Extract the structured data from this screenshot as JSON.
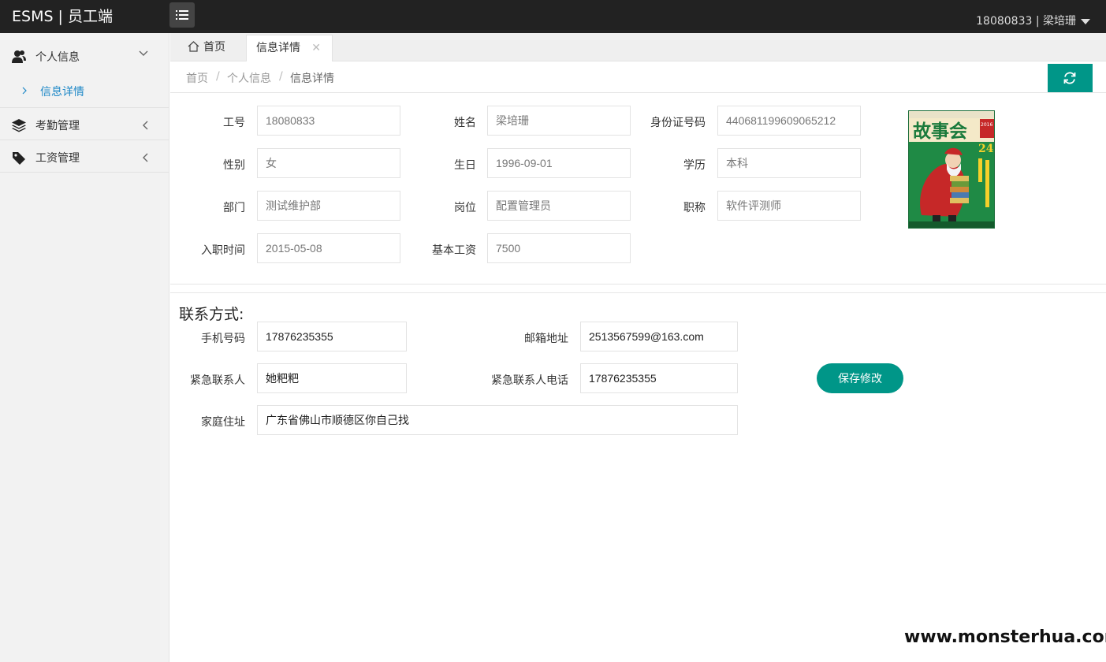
{
  "app": {
    "title": "ESMS | 员工端",
    "user": "18080833 | 梁培珊"
  },
  "sidebar": {
    "groups": [
      {
        "label": "个人信息",
        "icon": "users-icon",
        "expanded": true
      },
      {
        "label": "考勤管理",
        "icon": "layers-icon",
        "expanded": false
      },
      {
        "label": "工资管理",
        "icon": "tag-icon",
        "expanded": false
      }
    ],
    "sub_items": [
      {
        "label": "信息详情",
        "active": true
      }
    ]
  },
  "tabs": [
    {
      "label": "首页",
      "icon": "home-icon"
    },
    {
      "label": "信息详情",
      "active": true,
      "closable": true
    }
  ],
  "breadcrumb": [
    "首页",
    "个人信息",
    "信息详情"
  ],
  "profile": {
    "fields": [
      {
        "label": "工号",
        "value": "18080833"
      },
      {
        "label": "姓名",
        "value": "梁培珊"
      },
      {
        "label": "身份证号码",
        "value": "440681199609065212"
      },
      {
        "label": "性别",
        "value": "女"
      },
      {
        "label": "生日",
        "value": "1996-09-01"
      },
      {
        "label": "学历",
        "value": "本科"
      },
      {
        "label": "部门",
        "value": "测试维护部"
      },
      {
        "label": "岗位",
        "value": "配置管理员"
      },
      {
        "label": "职称",
        "value": "软件评测师"
      },
      {
        "label": "入职时间",
        "value": "2015-05-08"
      },
      {
        "label": "基本工资",
        "value": "7500"
      }
    ],
    "photo": {
      "title": "故事会",
      "issue": "24",
      "year": "2016"
    }
  },
  "contact": {
    "title": "联系方式:",
    "fields": [
      {
        "label": "手机号码",
        "value": "17876235355"
      },
      {
        "label": "邮箱地址",
        "value": "2513567599@163.com"
      },
      {
        "label": "紧急联系人",
        "value": "她粑粑"
      },
      {
        "label": "紧急联系人电话",
        "value": "17876235355"
      },
      {
        "label": "家庭住址",
        "value": "广东省佛山市顺德区你自己找"
      }
    ],
    "save_label": "保存修改"
  },
  "watermark": "www.monsterhua.com",
  "colors": {
    "topbar": "#222222",
    "accent": "#009688",
    "link": "#1e88c7",
    "sidebar": "#f2f2f2"
  }
}
